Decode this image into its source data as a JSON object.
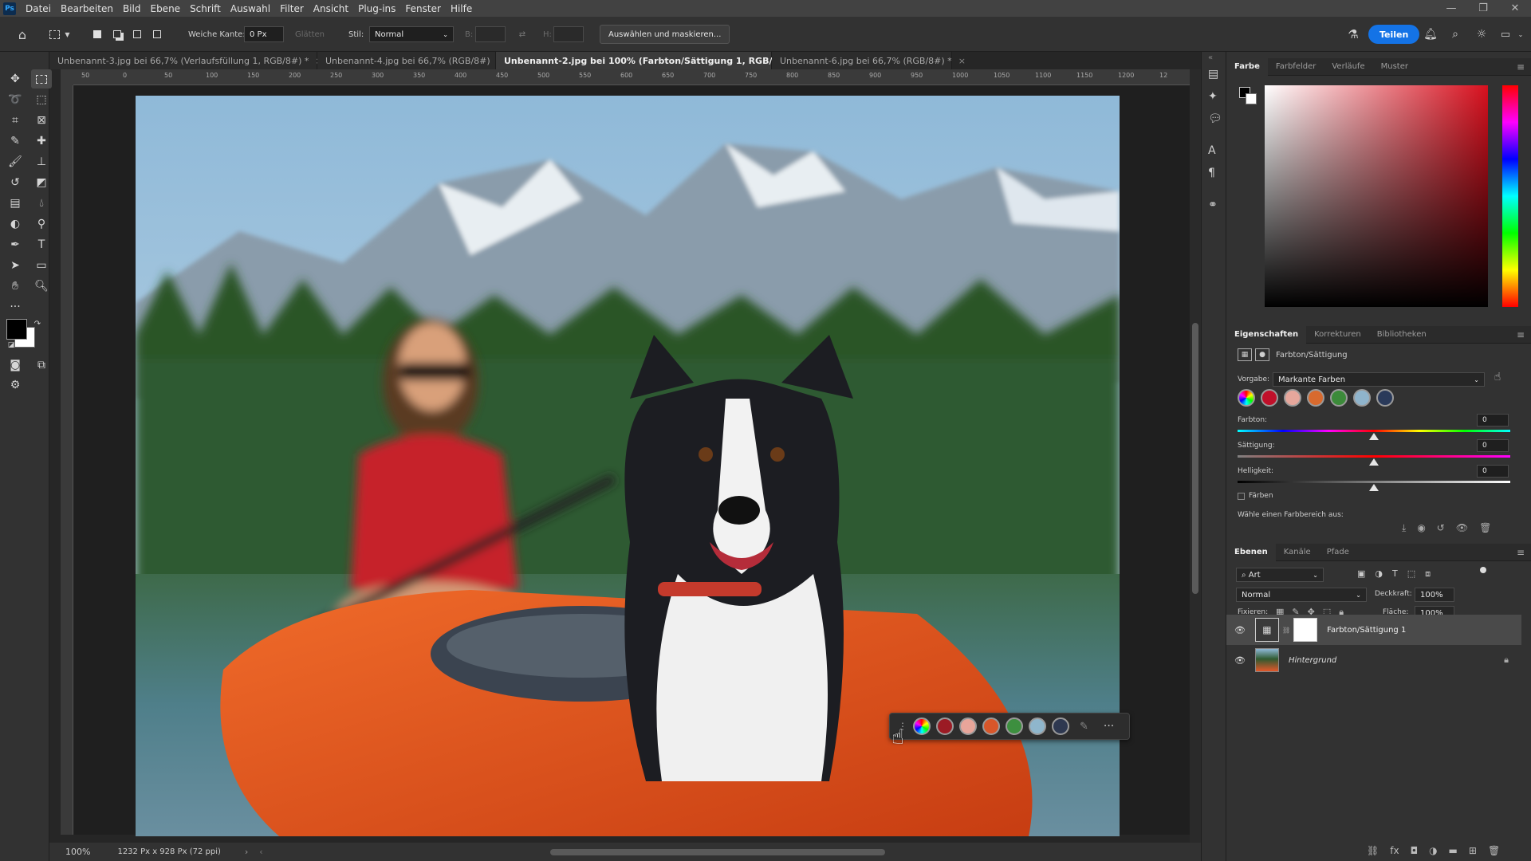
{
  "app": {
    "logo": "Ps"
  },
  "menu": [
    "Datei",
    "Bearbeiten",
    "Bild",
    "Ebene",
    "Schrift",
    "Auswahl",
    "Filter",
    "Ansicht",
    "Plug-ins",
    "Fenster",
    "Hilfe"
  ],
  "options": {
    "feather_label": "Weiche Kante:",
    "feather_value": "0 Px",
    "smooth_label": "Glätten",
    "style_label": "Stil:",
    "style_value": "Normal",
    "width_label": "B:",
    "height_label": "H:",
    "select_mask_button": "Auswählen und maskieren...",
    "share_button": "Teilen"
  },
  "tabs": [
    {
      "label": "Unbenannt-3.jpg bei 66,7% (Verlaufsfüllung 1, RGB/8#) *",
      "active": false
    },
    {
      "label": "Unbenannt-4.jpg bei 66,7% (RGB/8#)",
      "active": false
    },
    {
      "label": "Unbenannt-2.jpg bei 100% (Farbton/Sättigung 1, RGB/8#) *",
      "active": true
    },
    {
      "label": "Unbenannt-6.jpg bei 66,7% (RGB/8#) *",
      "active": false
    }
  ],
  "ruler_h": [
    "50",
    "0",
    "50",
    "100",
    "150",
    "200",
    "250",
    "300",
    "350",
    "400",
    "450",
    "500",
    "550",
    "600",
    "650",
    "700",
    "750",
    "800",
    "850",
    "900",
    "950",
    "1000",
    "1050",
    "1100",
    "1150",
    "1200",
    "12"
  ],
  "status": {
    "zoom": "100%",
    "doc_info": "1232 Px x 928 Px (72 ppi)"
  },
  "color_panel": {
    "tabs": [
      "Farbe",
      "Farbfelder",
      "Verläufe",
      "Muster"
    ],
    "hue_color": "#d8101e"
  },
  "properties": {
    "tabs": [
      "Eigenschaften",
      "Korrekturen",
      "Bibliotheken"
    ],
    "title": "Farbton/Sättigung",
    "preset_label": "Vorgabe:",
    "preset_value": "Markante Farben",
    "swatches": [
      "#c0102a",
      "#e6a79c",
      "#d86a2e",
      "#3c8a3a",
      "#8fb4cc",
      "#2a3a5a"
    ],
    "hue_label": "Farbton:",
    "hue_value": "0",
    "saturation_label": "Sättigung:",
    "saturation_value": "0",
    "lightness_label": "Helligkeit:",
    "lightness_value": "0",
    "colorize_label": "Färben",
    "range_hint": "Wähle einen Farbbereich aus:"
  },
  "layers": {
    "tabs": [
      "Ebenen",
      "Kanäle",
      "Pfade"
    ],
    "filter_value": "Art",
    "blend_mode": "Normal",
    "opacity_label": "Deckkraft:",
    "opacity_value": "100%",
    "lock_label": "Fixieren:",
    "fill_label": "Fläche:",
    "fill_value": "100%",
    "items": [
      {
        "name": "Farbton/Sättigung 1",
        "selected": true
      },
      {
        "name": "Hintergrund",
        "selected": false
      }
    ]
  },
  "context_bar": {
    "swatches": [
      "#9b1b24",
      "#e8a59a",
      "#d8562a",
      "#3d8f3f",
      "#8fb6cc",
      "#2e3850"
    ]
  }
}
